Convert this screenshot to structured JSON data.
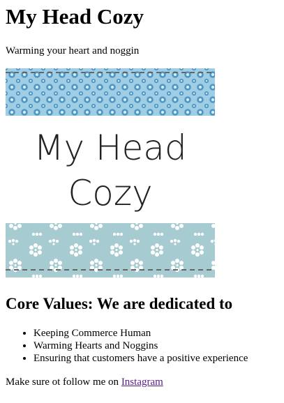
{
  "header": {
    "title": "My Head Cozy",
    "tagline": "Warming your heart and noggin"
  },
  "logo": {
    "line1": "My Head",
    "line2": "Cozy",
    "colors": {
      "top_pattern_bg": "#9fcde3",
      "top_pattern_flower": "#4f97c6",
      "bottom_pattern_bg": "#a6cbd1",
      "flower_white": "#ffffff",
      "dash": "#666666"
    }
  },
  "values": {
    "heading": "Core Values: We are dedicated to",
    "items": [
      "Keeping Commerce Human",
      "Warming Hearts and Noggins",
      "Ensuring that customers have a positive experience"
    ]
  },
  "footer": {
    "text": "Make sure ot follow me on ",
    "link_label": "Instagram",
    "link_color": "#551a8b"
  }
}
